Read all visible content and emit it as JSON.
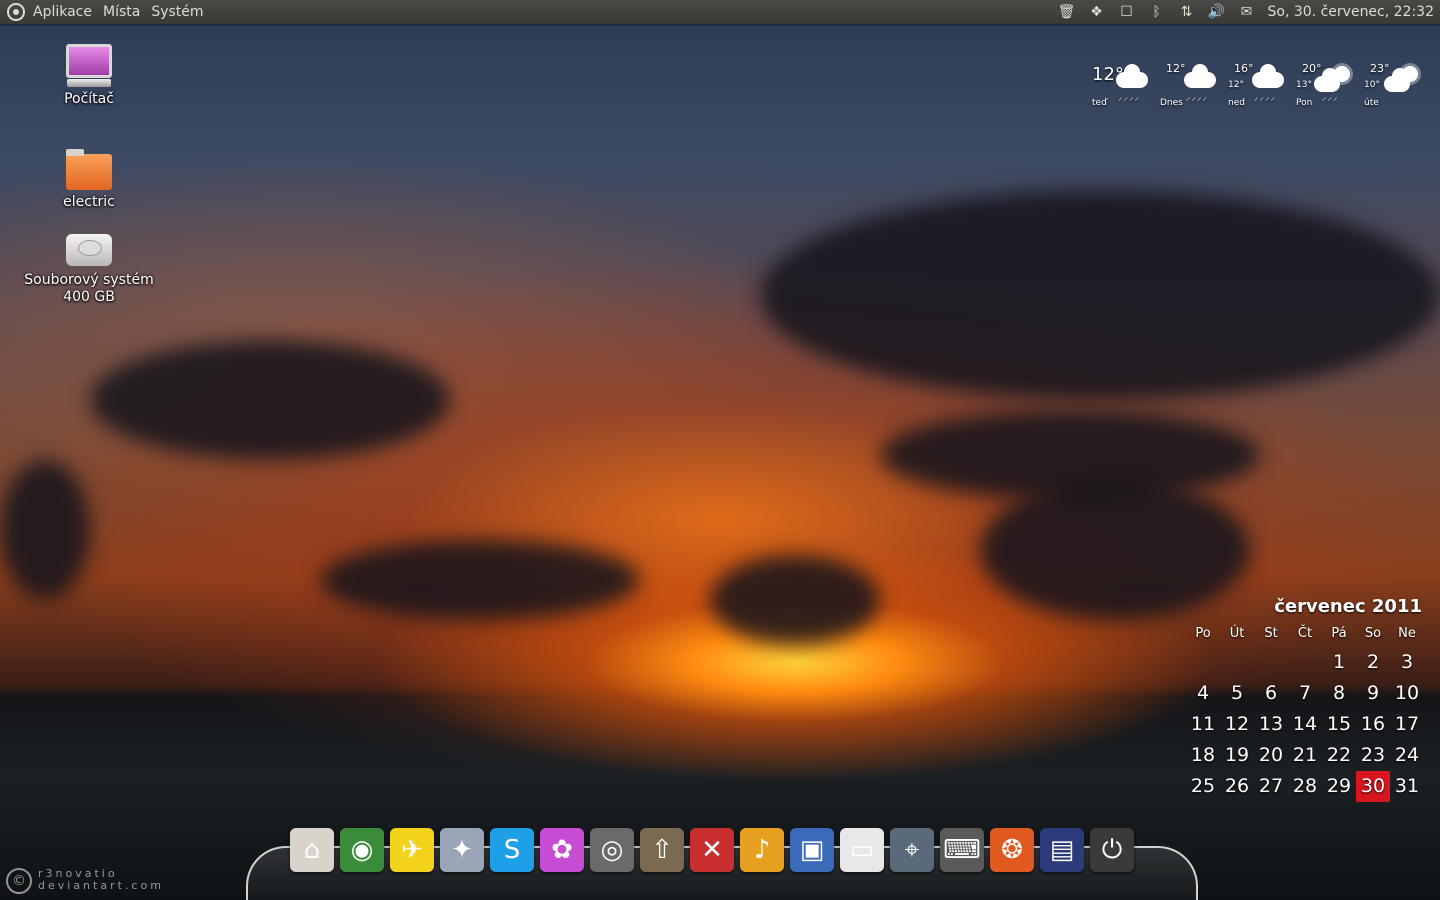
{
  "topbar": {
    "menus": [
      "Aplikace",
      "Místa",
      "Systém"
    ],
    "clock": "So, 30. červenec, 22:32"
  },
  "tray_icons": [
    "trash-icon",
    "dropbox-icon",
    "window-icon",
    "bluetooth-icon",
    "network-icon",
    "volume-icon",
    "mail-icon"
  ],
  "desktop": {
    "icons": [
      {
        "label": "Počítač",
        "icon": "computer-icon"
      },
      {
        "label": "electric",
        "icon": "folder-icon"
      },
      {
        "label": "Souborový systém",
        "sub": "400 GB",
        "icon": "harddisk-icon"
      }
    ]
  },
  "weather": [
    {
      "temp": "12°",
      "low": "",
      "name": "teď",
      "icon": "rain-icon"
    },
    {
      "temp": "12°",
      "low": "",
      "name": "Dnes",
      "icon": "rain-icon"
    },
    {
      "temp": "16°",
      "low": "12°",
      "name": "ned",
      "icon": "rain-icon"
    },
    {
      "temp": "20°",
      "low": "13°",
      "name": "Pon",
      "icon": "sun-rain-icon"
    },
    {
      "temp": "23°",
      "low": "10°",
      "name": "úte",
      "icon": "sun-cloud-icon"
    }
  ],
  "calendar": {
    "title": "červenec 2011",
    "weekdays": [
      "Po",
      "Út",
      "St",
      "Čt",
      "Pá",
      "So",
      "Ne"
    ],
    "weeks": [
      [
        "",
        "",
        "",
        "",
        "1",
        "2",
        "3"
      ],
      [
        "4",
        "5",
        "6",
        "7",
        "8",
        "9",
        "10"
      ],
      [
        "11",
        "12",
        "13",
        "14",
        "15",
        "16",
        "17"
      ],
      [
        "18",
        "19",
        "20",
        "21",
        "22",
        "23",
        "24"
      ],
      [
        "25",
        "26",
        "27",
        "28",
        "29",
        "30",
        "31"
      ]
    ],
    "today": "30"
  },
  "dock": [
    {
      "name": "home-icon",
      "glyph": "⌂",
      "color": "#d8d4cc"
    },
    {
      "name": "chrome-icon",
      "glyph": "◉",
      "color": "#3a8c3a"
    },
    {
      "name": "bird-icon",
      "glyph": "✈",
      "color": "#f2d21a"
    },
    {
      "name": "gwibber-icon",
      "glyph": "✦",
      "color": "#9aa6b8"
    },
    {
      "name": "skype-icon",
      "glyph": "S",
      "color": "#1ea0e8"
    },
    {
      "name": "picasa-icon",
      "glyph": "✿",
      "color": "#c84cd4"
    },
    {
      "name": "speaker-icon",
      "glyph": "◎",
      "color": "#6a6a6a"
    },
    {
      "name": "upload-icon",
      "glyph": "⇧",
      "color": "#7a6a50"
    },
    {
      "name": "tools-icon",
      "glyph": "✕",
      "color": "#c83030"
    },
    {
      "name": "rhythmbox-icon",
      "glyph": "♪",
      "color": "#e8a020"
    },
    {
      "name": "virtualbox-icon",
      "glyph": "▣",
      "color": "#3a6ab8"
    },
    {
      "name": "document-icon",
      "glyph": "▭",
      "color": "#e8e8e8"
    },
    {
      "name": "screenshot-icon",
      "glyph": "⌖",
      "color": "#5a6a7a"
    },
    {
      "name": "keyboard-icon",
      "glyph": "⌨",
      "color": "#5a5a5a"
    },
    {
      "name": "ubuntu-icon",
      "glyph": "❂",
      "color": "#e05a20"
    },
    {
      "name": "cpu-monitor-icon",
      "glyph": "▤",
      "color": "#2a3a7a"
    },
    {
      "name": "power-icon",
      "glyph": "⏻",
      "color": "#3a3a3a"
    }
  ],
  "watermark": {
    "line1": "r3novatio",
    "line2": "deviantart.com"
  }
}
